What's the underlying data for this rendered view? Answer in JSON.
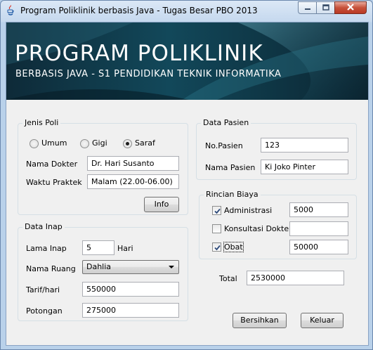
{
  "window": {
    "title": "Program Poliklinik berbasis Java - Tugas Besar PBO 2013",
    "controls": {
      "minimize": "minimize-icon",
      "maximize": "maximize-icon",
      "close": "close-icon"
    }
  },
  "banner": {
    "title": "PROGRAM POLIKLINIK",
    "subtitle": "BERBASIS JAVA - S1 PENDIDIKAN TEKNIK INFORMATIKA"
  },
  "jenis_poli": {
    "legend": "Jenis Poli",
    "options": [
      {
        "label": "Umum",
        "selected": false
      },
      {
        "label": "Gigi",
        "selected": false
      },
      {
        "label": "Saraf",
        "selected": true
      }
    ],
    "nama_dokter_label": "Nama Dokter",
    "nama_dokter_value": "Dr. Hari Susanto",
    "waktu_praktek_label": "Waktu Praktek",
    "waktu_praktek_value": "Malam (22.00-06.00)",
    "info_button": "Info"
  },
  "data_inap": {
    "legend": "Data Inap",
    "lama_inap_label": "Lama Inap",
    "lama_inap_value": "5",
    "hari_label": "Hari",
    "nama_ruang_label": "Nama Ruang",
    "nama_ruang_value": "Dahlia",
    "tarif_label": "Tarif/hari",
    "tarif_value": "550000",
    "potongan_label": "Potongan",
    "potongan_value": "275000"
  },
  "data_pasien": {
    "legend": "Data Pasien",
    "no_pasien_label": "No.Pasien",
    "no_pasien_value": "123",
    "nama_pasien_label": "Nama Pasien",
    "nama_pasien_value": "Ki Joko Pinter"
  },
  "rincian_biaya": {
    "legend": "Rincian Biaya",
    "items": [
      {
        "label": "Administrasi",
        "checked": true,
        "value": "5000"
      },
      {
        "label": "Konsultasi Dokter",
        "checked": false,
        "value": ""
      },
      {
        "label": "Obat",
        "checked": true,
        "value": "50000"
      }
    ]
  },
  "total": {
    "label": "Total",
    "value": "2530000"
  },
  "buttons": {
    "bersihkan": "Bersihkan",
    "keluar": "Keluar"
  },
  "colors": {
    "banner_dark": "#0d3140",
    "banner_accent": "#3f8aa0",
    "window_frame": "#b9d1ea",
    "close_button": "#c7513a"
  }
}
